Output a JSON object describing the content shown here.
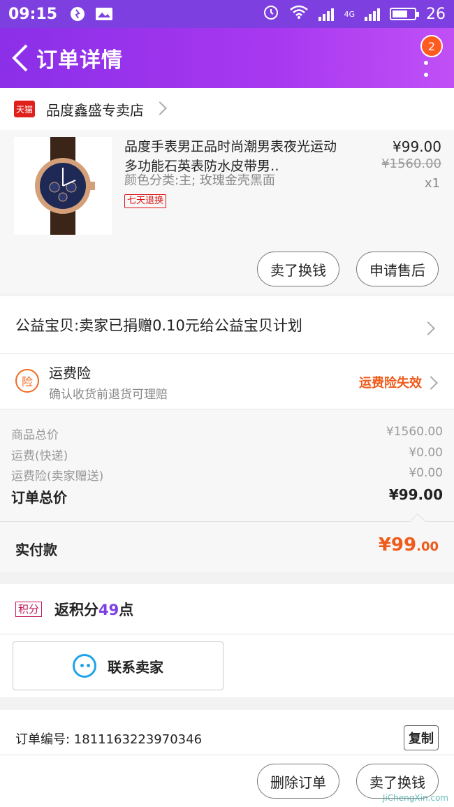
{
  "status_bar": {
    "time": "09:15",
    "network": "4G",
    "battery": "26"
  },
  "header": {
    "title": "订单详情",
    "notification_count": "2"
  },
  "shop": {
    "badge": "天猫",
    "name": "品度鑫盛专卖店"
  },
  "product": {
    "title": "品度手表男正品时尚潮男表夜光运动多功能石英表防水皮带男‥",
    "sku": "颜色分类:主; 玫瑰金壳黑面",
    "tag": "七天退换",
    "price": "¥99.00",
    "original_price": "¥1560.00",
    "quantity": "x1",
    "buttons": {
      "sell": "卖了换钱",
      "after_sale": "申请售后"
    }
  },
  "charity": {
    "text": "公益宝贝:卖家已捐赠0.10元给公益宝贝计划"
  },
  "insurance": {
    "icon_text": "险",
    "title": "运费险",
    "subtitle": "确认收货前退货可理赔",
    "status": "运费险失效"
  },
  "totals": {
    "rows": [
      {
        "label": "商品总价",
        "value": "¥1560.00"
      },
      {
        "label": "运费(快递)",
        "value": "¥0.00"
      },
      {
        "label": "运费险(卖家赠送)",
        "value": "¥0.00"
      }
    ],
    "order_total_label": "订单总价",
    "order_total_value": "¥99.00"
  },
  "payment": {
    "label": "实付款",
    "value_main": "¥99",
    "value_decimal": ".00"
  },
  "points": {
    "badge": "积分",
    "prefix": "返积分",
    "amount": "49",
    "suffix": "点"
  },
  "contact": {
    "label": "联系卖家"
  },
  "order": {
    "number_text": "订单编号: 1811163223970346",
    "copy_label": "复制"
  },
  "bottom_bar": {
    "delete_label": "删除订单",
    "sell_label": "卖了换钱"
  },
  "watermark": "JiChengXin.com",
  "colors": {
    "primary": "#8b2fe8",
    "accent": "#f05a1a",
    "link_blue": "#1fa3e8"
  }
}
